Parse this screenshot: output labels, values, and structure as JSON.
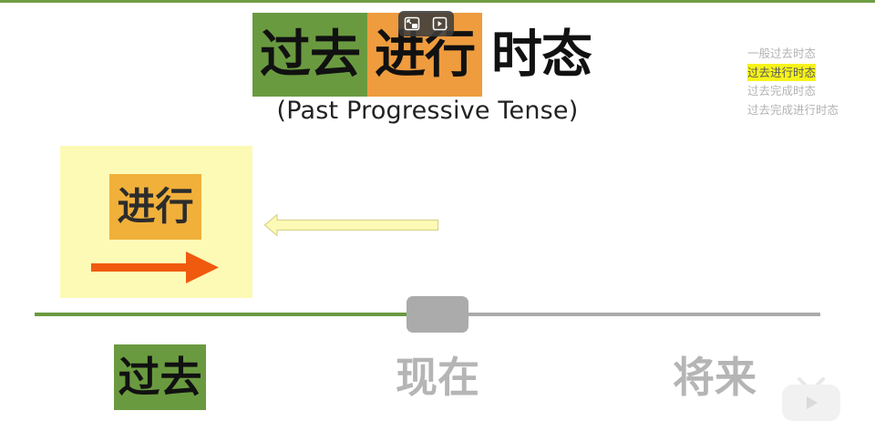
{
  "title": {
    "past": "过去",
    "progressive": "进行",
    "tense": "时态",
    "subtitle": "(Past Progressive Tense)"
  },
  "tense_menu": {
    "items": [
      "一般过去时态",
      "过去进行时态",
      "过去完成时态",
      "过去完成进行时态"
    ],
    "active_index": 1
  },
  "card": {
    "label": "进行"
  },
  "timeline": {
    "labels": {
      "past": "过去",
      "now": "现在",
      "future": "将来"
    },
    "position": 0.5
  },
  "colors": {
    "green": "#6a9a40",
    "orange": "#ee9c3e",
    "card_bg": "#fdfab5",
    "card_label_bg": "#f0b03a",
    "arrow": "#f05a0f",
    "highlight": "#f7f31a",
    "grey": "#ababab"
  },
  "icons": {
    "overlay": [
      "pip-icon",
      "video-assist-icon"
    ],
    "logo": "bilibili-tv-icon"
  }
}
